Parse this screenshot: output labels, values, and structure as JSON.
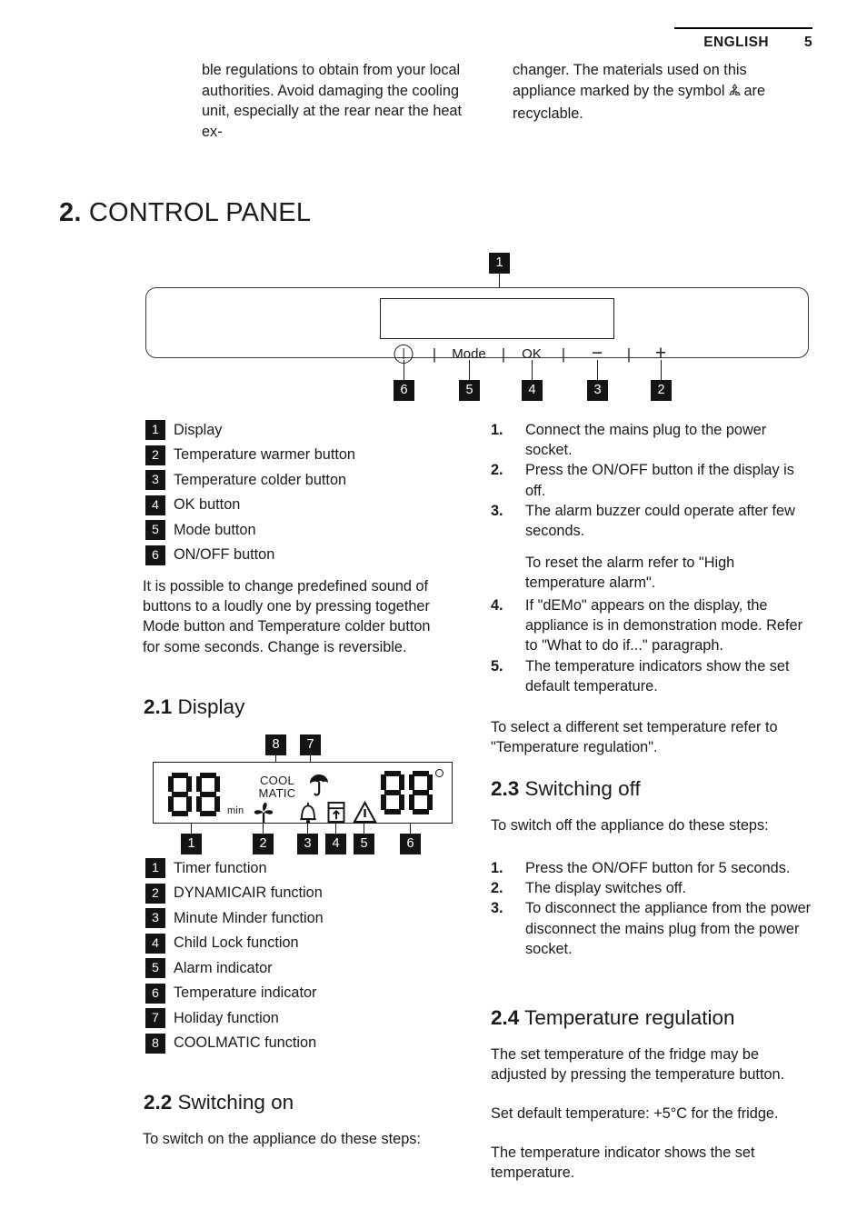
{
  "header": {
    "language": "ENGLISH",
    "page_number": "5"
  },
  "intro": {
    "left": "ble regulations to obtain from your local authorities. Avoid damaging the cooling unit, especially at the rear near the heat ex-",
    "right_before": "changer. The materials used on this appliance marked by the symbol",
    "right_after": "are recyclable."
  },
  "chapter": {
    "number": "2.",
    "title": "CONTROL PANEL"
  },
  "control_panel": {
    "buttons": [
      {
        "label": "power-icon",
        "type": "icon"
      },
      {
        "label": "Mode",
        "type": "text"
      },
      {
        "label": "OK",
        "type": "text"
      },
      {
        "label": "−",
        "type": "text"
      },
      {
        "label": "+",
        "type": "text"
      }
    ],
    "separator": "|",
    "callouts_below": [
      "6",
      "5",
      "4",
      "3",
      "2"
    ],
    "callout_display": "1"
  },
  "panel_legend": [
    {
      "num": "1",
      "label": "Display"
    },
    {
      "num": "2",
      "label": "Temperature warmer button"
    },
    {
      "num": "3",
      "label": "Temperature colder button"
    },
    {
      "num": "4",
      "label": "OK button"
    },
    {
      "num": "5",
      "label": "Mode button"
    },
    {
      "num": "6",
      "label": "ON/OFF button"
    }
  ],
  "panel_note": "It is possible to change predefined sound of buttons to a loudly one by pressing together Mode button and Temperature colder button for some seconds. Change is reversible.",
  "section_display": {
    "number": "2.1",
    "title": "Display",
    "figure": {
      "left_digits": "88",
      "left_unit": "min",
      "right_digits": "88",
      "right_unit": "°",
      "coolmatic_line1": "COOL",
      "coolmatic_line2": "MATIC",
      "icons": [
        "fan-icon",
        "bell-icon",
        "child-lock-icon",
        "warning-triangle-icon",
        "umbrella-icon"
      ],
      "callouts_below": [
        "1",
        "2",
        "3",
        "4",
        "5",
        "6"
      ],
      "callouts_above": [
        "8",
        "7"
      ]
    },
    "legend": [
      {
        "num": "1",
        "label": "Timer function"
      },
      {
        "num": "2",
        "label": "DYNAMICAIR function"
      },
      {
        "num": "3",
        "label": "Minute Minder function"
      },
      {
        "num": "4",
        "label": "Child Lock function"
      },
      {
        "num": "5",
        "label": "Alarm indicator"
      },
      {
        "num": "6",
        "label": "Temperature indicator"
      },
      {
        "num": "7",
        "label": "Holiday function"
      },
      {
        "num": "8",
        "label": "COOLMATIC function"
      }
    ]
  },
  "section_switching_on": {
    "number": "2.2",
    "title": "Switching on",
    "intro": "To switch on the appliance do these steps:",
    "steps": [
      {
        "num": "1.",
        "text": "Connect the mains plug to the power socket."
      },
      {
        "num": "2.",
        "text": "Press the ON/OFF button if the display is off."
      },
      {
        "num": "3.",
        "text": "The alarm buzzer could operate after few seconds."
      },
      {
        "num": "4.",
        "text": "If \"dEMo\" appears on the display, the appliance is in demonstration mode. Refer to \"What to do if...\" paragraph."
      },
      {
        "num": "5.",
        "text": "The temperature indicators show the set default temperature."
      }
    ],
    "step3_note": "To reset the alarm refer to \"High temperature alarm\".",
    "closing": "To select a different set temperature refer to \"Temperature regulation\"."
  },
  "section_switching_off": {
    "number": "2.3",
    "title": "Switching off",
    "intro": "To switch off the appliance do these steps:",
    "steps": [
      {
        "num": "1.",
        "text": "Press the ON/OFF button for 5 seconds."
      },
      {
        "num": "2.",
        "text": "The display switches off."
      },
      {
        "num": "3.",
        "text": "To disconnect the appliance from the power disconnect the mains plug from the power socket."
      }
    ]
  },
  "section_temperature": {
    "number": "2.4",
    "title": "Temperature regulation",
    "paragraphs": [
      "The set temperature of the fridge may be adjusted by pressing the temperature button.",
      "Set default temperature: +5°C for the fridge.",
      "The temperature indicator shows the set temperature."
    ]
  }
}
